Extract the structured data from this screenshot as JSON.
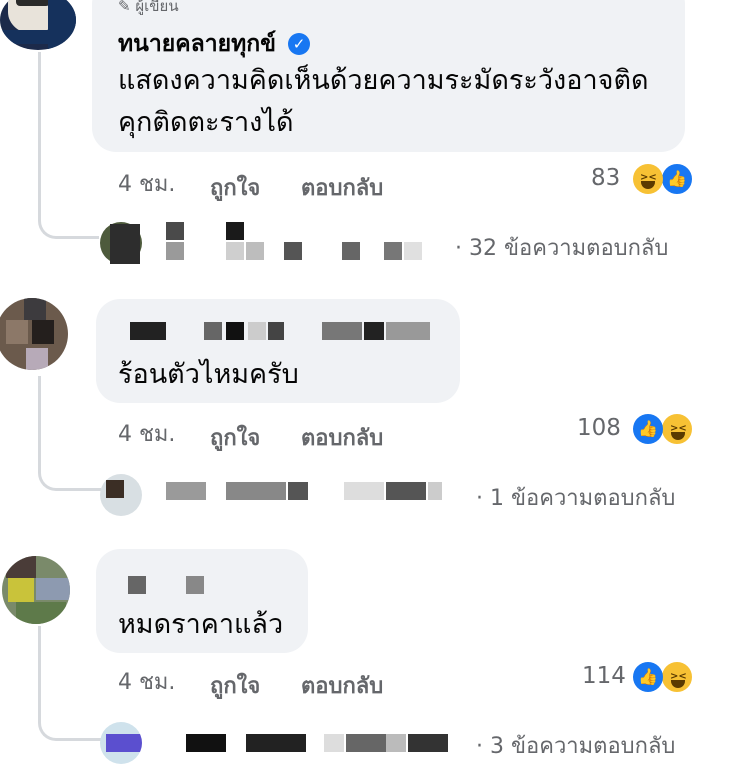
{
  "comments": [
    {
      "author_tag": "ผู้เขียน",
      "name": "ทนายคลายทุกข์",
      "verified": true,
      "text_lines": [
        "แสดงความคิดเห็นด้วยความระมัดระวังอาจติด",
        "คุกติดตะรางได้"
      ],
      "time": "4 ชม.",
      "like_label": "ถูกใจ",
      "reply_label": "ตอบกลับ",
      "reaction_count": "83",
      "reactions": [
        "haha-icon",
        "like-icon"
      ],
      "reply_summary": "· 32 ข้อความตอบกลับ"
    },
    {
      "text_lines": [
        "ร้อนตัวไหมครับ"
      ],
      "time": "4 ชม.",
      "like_label": "ถูกใจ",
      "reply_label": "ตอบกลับ",
      "reaction_count": "108",
      "reactions": [
        "like-icon",
        "haha-icon"
      ],
      "reply_summary": "· 1 ข้อความตอบกลับ"
    },
    {
      "text_lines": [
        "หมดราคาแล้ว"
      ],
      "time": "4 ชม.",
      "like_label": "ถูกใจ",
      "reply_label": "ตอบกลับ",
      "reaction_count": "114",
      "reactions": [
        "like-icon",
        "haha-icon"
      ],
      "reply_summary": "· 3 ข้อความตอบกลับ"
    }
  ],
  "colors": {
    "bubble": "#f0f2f5",
    "meta_text": "#65676b",
    "like_blue": "#1877f2",
    "haha_yellow": "#f7c134",
    "thread_line": "#d6d9dd"
  }
}
